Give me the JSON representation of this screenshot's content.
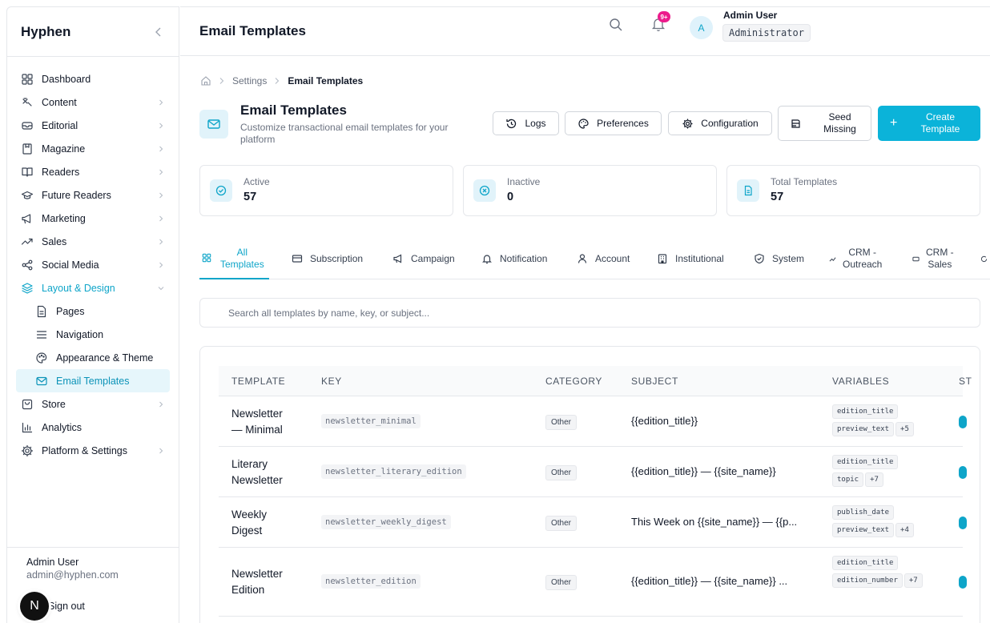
{
  "app": {
    "brand": "Hyphen"
  },
  "sidebar": {
    "items": [
      {
        "label": "Dashboard",
        "icon": "dashboard-grid-icon",
        "chevron": false
      },
      {
        "label": "Content",
        "icon": "content-icon",
        "chevron": true
      },
      {
        "label": "Editorial",
        "icon": "editorial-icon",
        "chevron": true
      },
      {
        "label": "Magazine",
        "icon": "magazine-icon",
        "chevron": true
      },
      {
        "label": "Readers",
        "icon": "readers-book-icon",
        "chevron": true
      },
      {
        "label": "Future Readers",
        "icon": "graduation-cap-icon",
        "chevron": true
      },
      {
        "label": "Marketing",
        "icon": "megaphone-icon",
        "chevron": true
      },
      {
        "label": "Sales",
        "icon": "trending-icon",
        "chevron": true
      },
      {
        "label": "Social Media",
        "icon": "share-icon",
        "chevron": true
      },
      {
        "label": "Layout & Design",
        "icon": "layers-icon",
        "chevron": true,
        "expanded": true
      },
      {
        "label": "Pages",
        "icon": "file-icon",
        "sub": true
      },
      {
        "label": "Navigation",
        "icon": "menu-icon",
        "sub": true
      },
      {
        "label": "Appearance & Theme",
        "icon": "palette-icon",
        "sub": true
      },
      {
        "label": "Email Templates",
        "icon": "mail-icon",
        "sub": true,
        "selected": true
      },
      {
        "label": "Store",
        "icon": "store-bag-icon",
        "chevron": true
      },
      {
        "label": "Analytics",
        "icon": "analytics-bars-icon",
        "chevron": false
      },
      {
        "label": "Platform & Settings",
        "icon": "settings-cog-icon",
        "chevron": true
      }
    ],
    "footer": {
      "name": "Admin User",
      "email": "admin@hyphen.com",
      "signout": "Sign out",
      "badge": "N"
    }
  },
  "topbar": {
    "title": "Email Templates",
    "notif_count": "9+",
    "avatar_initial": "A",
    "user_name": "Admin User",
    "user_role": "Administrator"
  },
  "breadcrumb": {
    "parent": "Settings",
    "current": "Email Templates"
  },
  "header": {
    "title": "Email Templates",
    "subtitle": "Customize transactional email templates for your platform",
    "buttons": {
      "logs": "Logs",
      "preferences": "Preferences",
      "configuration": "Configuration",
      "seed_line1": "Seed",
      "seed_line2": "Missing",
      "create_line1": "Create",
      "create_line2": "Template"
    }
  },
  "stats": {
    "active": {
      "label": "Active",
      "value": "57"
    },
    "inactive": {
      "label": "Inactive",
      "value": "0"
    },
    "total": {
      "label": "Total Templates",
      "value": "57"
    }
  },
  "tabs": {
    "all_1": "All",
    "all_2": "Templates",
    "subscription": "Subscription",
    "campaign": "Campaign",
    "notification": "Notification",
    "account": "Account",
    "institutional": "Institutional",
    "system": "System",
    "crm_outreach_1": "CRM -",
    "crm_outreach_2": "Outreach",
    "crm_sales_1": "CRM -",
    "crm_sales_2": "Sales"
  },
  "search": {
    "placeholder": "Search all templates by name, key, or subject..."
  },
  "table": {
    "headers": {
      "template": "TEMPLATE",
      "key": "KEY",
      "category": "CATEGORY",
      "subject": "SUBJECT",
      "variables": "VARIABLES",
      "status": "ST"
    },
    "rows": [
      {
        "name1": "Newsletter",
        "name2": "— Minimal",
        "key": "newsletter_minimal",
        "category": "Other",
        "subject": "{{edition_title}}",
        "vars": [
          "edition_title",
          "preview_text"
        ],
        "more": "+5"
      },
      {
        "name1": "Literary",
        "name2": "Newsletter",
        "key": "newsletter_literary_edition",
        "category": "Other",
        "subject": "{{edition_title}} — {{site_name}}",
        "vars": [
          "edition_title",
          "topic"
        ],
        "more": "+7"
      },
      {
        "name1": "Weekly",
        "name2": "Digest",
        "key": "newsletter_weekly_digest",
        "category": "Other",
        "subject": "This Week on {{site_name}} — {{p...",
        "vars": [
          "publish_date",
          "preview_text"
        ],
        "more": "+4"
      },
      {
        "name1": "Newsletter",
        "name2": "Edition",
        "key": "newsletter_edition",
        "category": "Other",
        "subject": "{{edition_title}} — {{site_name}} ...",
        "vars": [
          "edition_title",
          "edition_number"
        ],
        "more": "+7"
      }
    ]
  },
  "colors": {
    "accent": "#0bb3d9",
    "badge": "#ec1c8c"
  }
}
